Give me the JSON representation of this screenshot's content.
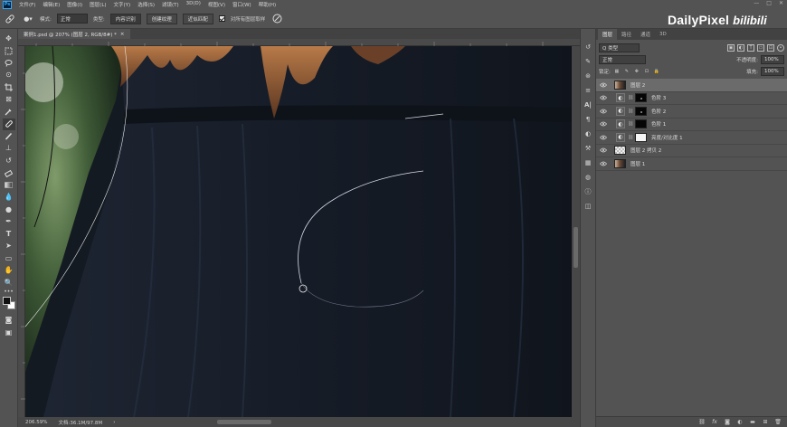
{
  "app": {
    "logo": "Ps"
  },
  "menu": [
    "文件(F)",
    "编辑(E)",
    "图像(I)",
    "图层(L)",
    "文字(Y)",
    "选择(S)",
    "滤镜(T)",
    "3D(D)",
    "视图(V)",
    "窗口(W)",
    "帮助(H)"
  ],
  "window_controls": {
    "minimize": "—",
    "maximize": "□",
    "close": "✕"
  },
  "options": {
    "mode_label": "模式:",
    "mode_value": "正常",
    "type_label": "类型:",
    "btn_content_aware": "内容识别",
    "btn_create_texture": "创建纹理",
    "btn_proximity": "近似匹配",
    "sample_all_label": "对所有图层取样"
  },
  "watermark": {
    "text": "DailyPixel",
    "site": "bilibili"
  },
  "document": {
    "tab_title": "案例1.psd @ 207% (图层 2, RGB/8#) *",
    "close": "×"
  },
  "status": {
    "zoom": "206.59%",
    "doc_size": "文档:36.1M/97.8M",
    "arrow": "›"
  },
  "panel": {
    "tabs": [
      "图层",
      "路径",
      "通道",
      "3D"
    ],
    "filter_label": "Q 类型",
    "blend_mode": "正常",
    "opacity_label": "不透明度:",
    "opacity_value": "100%",
    "lock_label": "锁定:",
    "fill_label": "填充:",
    "fill_value": "100%",
    "layers": [
      {
        "name": "图层 2",
        "thumb": "photo",
        "selected": true,
        "adj": false
      },
      {
        "name": "色阶 3",
        "thumb": "black",
        "selected": false,
        "adj": true
      },
      {
        "name": "色阶 2",
        "thumb": "black",
        "selected": false,
        "adj": true
      },
      {
        "name": "色阶 1",
        "thumb": "black",
        "selected": false,
        "adj": true
      },
      {
        "name": "亮度/对比度 1",
        "thumb": "white",
        "selected": false,
        "adj": true
      },
      {
        "name": "图层 2 拷贝 2",
        "thumb": "check",
        "selected": false,
        "adj": false
      },
      {
        "name": "图层 1",
        "thumb": "photo",
        "selected": false,
        "adj": false
      }
    ]
  },
  "colors": {
    "ui_bg": "#535353",
    "panel_dark": "#424242",
    "selected_layer": "#6b6b6b",
    "canvas_dark": "#141a22"
  }
}
